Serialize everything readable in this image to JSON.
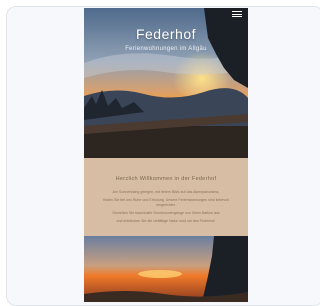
{
  "hero": {
    "title": "Federhof",
    "subtitle": "Ferienwohnungen im Allgäu",
    "menu_icon": "hamburger-menu-icon"
  },
  "textblock": {
    "heading": "Herzlich Willkommen in der Federhof",
    "paragraphs": [
      "Am Sonnenhang gelegen, mit freiem Blick auf das Alpenpanorama,",
      "finden Sie bei uns Ruhe und Erholung. Unsere Ferienwohnungen sind liebevoll eingerichtet.",
      "Genießen Sie traumhafte Sonnenuntergänge von Ihrem Balkon aus",
      "und entdecken Sie die vielfältige Natur rund um den Federhof."
    ]
  },
  "colors": {
    "accent": "#d6bda4",
    "text": "#8a735c"
  }
}
